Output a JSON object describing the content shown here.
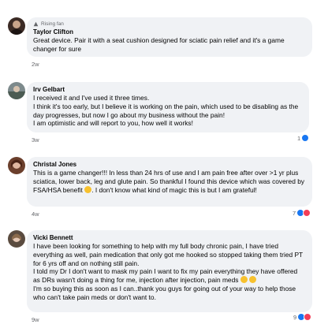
{
  "comments": [
    {
      "badge": "Rising fan",
      "name": "Taylor Clifton",
      "lines": [
        "Great device. Pair it with a seat cushion designed for sciatic pain relief and it's a game changer for sure"
      ],
      "time": "2w",
      "reaction_count": ""
    },
    {
      "name": "Irv Gelbart",
      "lines": [
        "I received it and I've used it three times.",
        "I think it's too early, but I believe it is working on the pain, which used to be disabling as the day progresses, but now I go about my business without the pain!",
        "I am optimistic and will report to you, how well it works!"
      ],
      "time": "3w",
      "reaction_count": "1"
    },
    {
      "name": "Christal Jones",
      "lines": [
        "This is a game changer!!! In less than 24 hrs of use and I am pain free after over >1 yr plus sciatica, lower back, leg and glute pain. So thankful I found this device which was covered by FSA/HSA benefit",
        ". I don't know what kind of magic this is but I am grateful!"
      ],
      "time": "4w",
      "reaction_count": "7"
    },
    {
      "name": "Vicki Bennett",
      "lines": [
        "I have been looking for something to help with my full body chronic pain, I have tried everything as well, pain medication that only got me hooked so stopped taking them tried PT for 6 yrs off and on nothing still pain.",
        "I told my Dr I don't want to mask my pain I want to fix my pain everything they have offered as DRs wasn't doing a thing for me, injection after injection, pain meds",
        "I'm so buying this as soon as I can..thank you guys for going out of your way to help those who can't take pain meds or don't want to."
      ],
      "time": "9w",
      "reaction_count": "9"
    }
  ],
  "colors": {
    "bubble": "#f0f2f5",
    "like": "#1877f2",
    "heart": "#f33e58",
    "meta": "#65676b"
  },
  "icons": [
    "rising-fan-badge-icon",
    "like-reaction-icon",
    "love-reaction-icon",
    "smile-emoji-icon"
  ]
}
